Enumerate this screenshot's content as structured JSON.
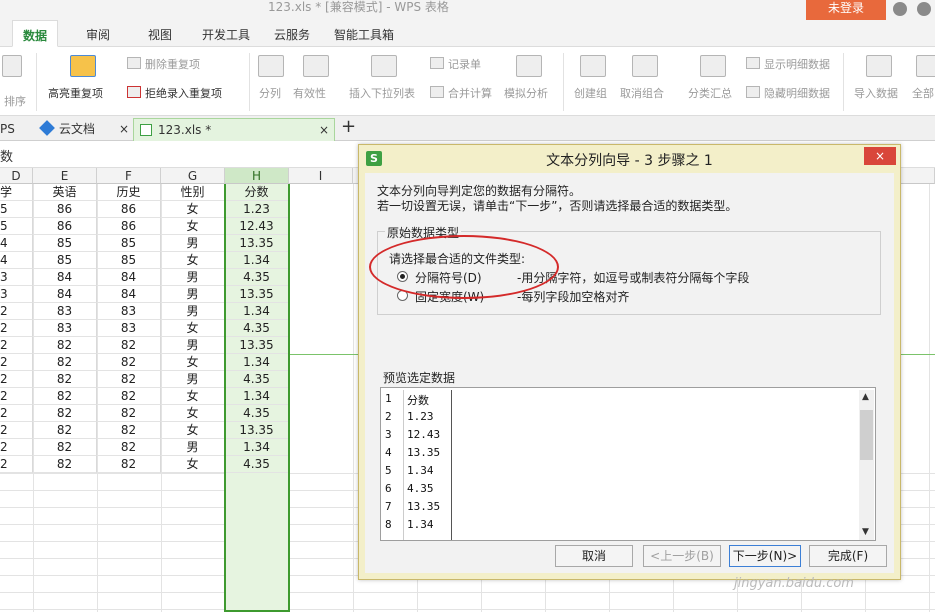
{
  "window": {
    "title": "123.xls * [兼容模式] - WPS 表格",
    "login_label": "未登录"
  },
  "menu": {
    "tabs": [
      "数据",
      "审阅",
      "视图",
      "开发工具",
      "云服务",
      "智能工具箱"
    ],
    "active": "数据"
  },
  "ribbon": {
    "sort": "排序",
    "highlight_dup": "高亮重复项",
    "delete_dup": "删除重复项",
    "reject_dup": "拒绝录入重复项",
    "split": "分列",
    "validity": "有效性",
    "insert_dropdown": "插入下拉列表",
    "record_sheet": "记录单",
    "merge_calc": "合并计算",
    "simulate": "模拟分析",
    "create_group": "创建组",
    "ungroup": "取消组合",
    "subtotal": "分类汇总",
    "show_detail": "显示明细数据",
    "hide_detail": "隐藏明细数据",
    "import_data": "导入数据",
    "all": "全部"
  },
  "doc_tabs": {
    "wps_label": "PS",
    "cloud_label": "云文档",
    "file_label": "123.xls *",
    "close": "×",
    "add": "+"
  },
  "formula_bar": {
    "cell_ref": "数"
  },
  "sheet": {
    "columns": [
      "D",
      "E",
      "F",
      "G",
      "H",
      "I"
    ],
    "selected_column": "H",
    "header_row": [
      "学",
      "英语",
      "历史",
      "性别",
      "分数"
    ],
    "rows": [
      [
        "5",
        "86",
        "86",
        "女",
        "1.23"
      ],
      [
        "5",
        "86",
        "86",
        "女",
        "12.43"
      ],
      [
        "4",
        "85",
        "85",
        "男",
        "13.35"
      ],
      [
        "4",
        "85",
        "85",
        "女",
        "1.34"
      ],
      [
        "3",
        "84",
        "84",
        "男",
        "4.35"
      ],
      [
        "3",
        "84",
        "84",
        "男",
        "13.35"
      ],
      [
        "2",
        "83",
        "83",
        "男",
        "1.34"
      ],
      [
        "2",
        "83",
        "83",
        "女",
        "4.35"
      ],
      [
        "2",
        "82",
        "82",
        "男",
        "13.35"
      ],
      [
        "2",
        "82",
        "82",
        "女",
        "1.34"
      ],
      [
        "2",
        "82",
        "82",
        "男",
        "4.35"
      ],
      [
        "2",
        "82",
        "82",
        "女",
        "1.34"
      ],
      [
        "2",
        "82",
        "82",
        "女",
        "4.35"
      ],
      [
        "2",
        "82",
        "82",
        "女",
        "13.35"
      ],
      [
        "2",
        "82",
        "82",
        "男",
        "1.34"
      ],
      [
        "2",
        "82",
        "82",
        "女",
        "4.35"
      ]
    ]
  },
  "dialog": {
    "title": "文本分列向导 - 3 步骤之 1",
    "icon_label": "S",
    "close": "×",
    "intro_line1": "文本分列向导判定您的数据有分隔符。",
    "intro_line2": "若一切设置无误，请单击“下一步”，否则请选择最合适的数据类型。",
    "group_title": "原始数据类型",
    "choose_label": "请选择最合适的文件类型:",
    "option_delimited": "分隔符号(D)",
    "option_delimited_desc": "-用分隔字符，如逗号或制表符分隔每个字段",
    "option_fixed": "固定宽度(W)",
    "option_fixed_desc": "-每列字段加空格对齐",
    "selected_option": "delimited",
    "preview_title": "预览选定数据",
    "preview_rows": [
      [
        "1",
        "分数"
      ],
      [
        "2",
        "1.23"
      ],
      [
        "3",
        "12.43"
      ],
      [
        "4",
        "13.35"
      ],
      [
        "5",
        "1.34"
      ],
      [
        "6",
        "4.35"
      ],
      [
        "7",
        "13.35"
      ],
      [
        "8",
        "1.34"
      ]
    ],
    "btn_cancel": "取消",
    "btn_prev": "<上一步(B)",
    "btn_next": "下一步(N)>",
    "btn_finish": "完成(F)"
  },
  "watermark": "jingyan.baidu.com"
}
